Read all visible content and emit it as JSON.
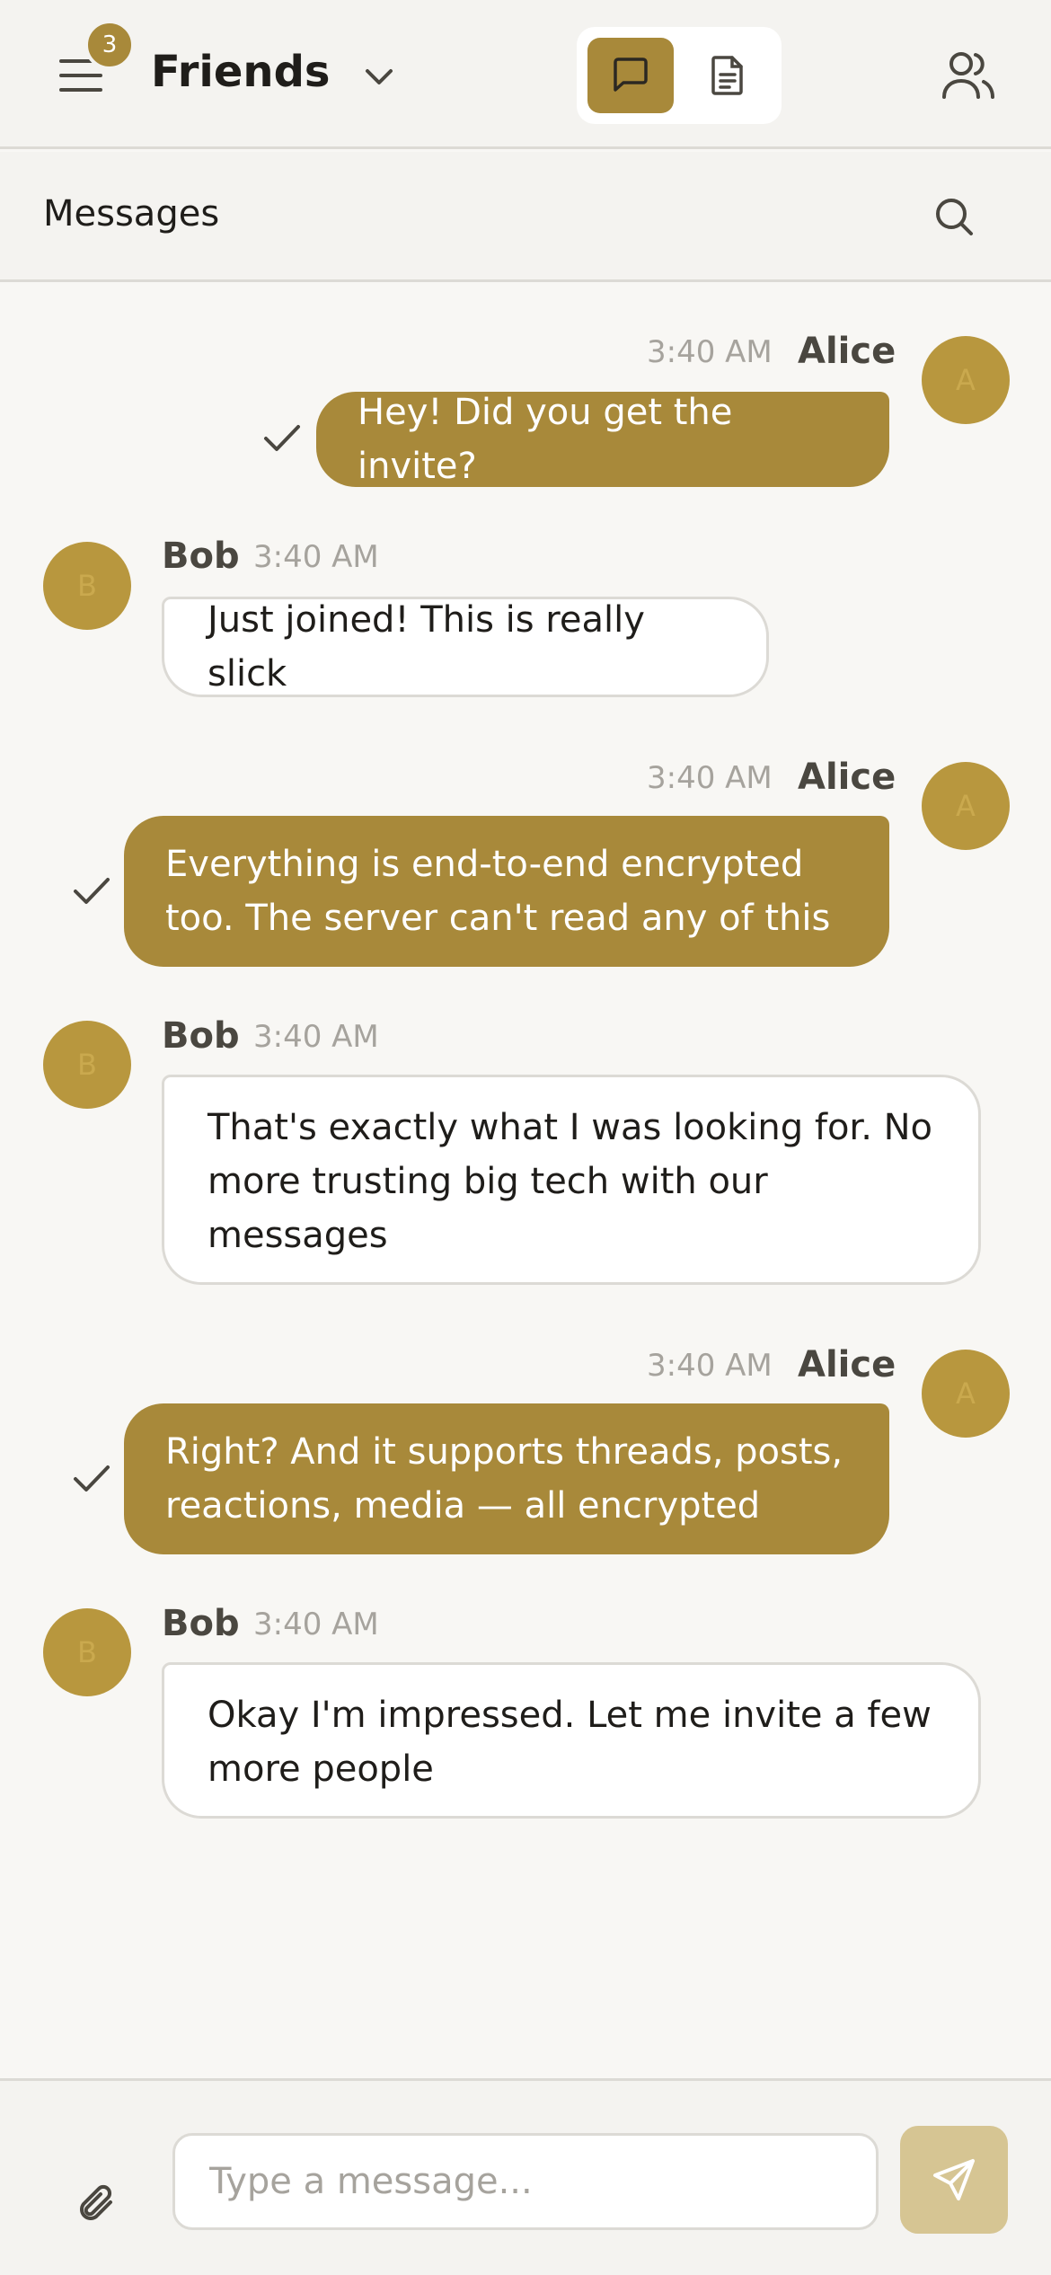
{
  "header": {
    "menu_badge_count": "3",
    "group_name": "Friends",
    "icons": {
      "menu": "menu-icon",
      "chevron": "chevron-down-icon",
      "chat_view": "chat-bubble-icon",
      "posts_view": "document-icon",
      "members": "users-icon"
    },
    "accent_color": "#a8893a"
  },
  "subheader": {
    "title": "Messages",
    "search_icon": "search-icon"
  },
  "messages": [
    {
      "author": "Alice",
      "avatar_letter": "A",
      "time": "3:40 AM",
      "direction": "outgoing",
      "text": "Hey! Did you get the invite?",
      "status": "check-icon"
    },
    {
      "author": "Bob",
      "avatar_letter": "B",
      "time": "3:40 AM",
      "direction": "incoming",
      "text": "Just joined! This is really slick"
    },
    {
      "author": "Alice",
      "avatar_letter": "A",
      "time": "3:40 AM",
      "direction": "outgoing",
      "lines": [
        "Everything is end-to-end encrypted",
        "too. The server can't read any of this"
      ],
      "status": "check-icon"
    },
    {
      "author": "Bob",
      "avatar_letter": "B",
      "time": "3:40 AM",
      "direction": "incoming",
      "lines": [
        "That's exactly what I was looking for. No",
        "more trusting big tech with our",
        "messages"
      ]
    },
    {
      "author": "Alice",
      "avatar_letter": "A",
      "time": "3:40 AM",
      "direction": "outgoing",
      "lines": [
        "Right? And it supports threads, posts,",
        "reactions, media — all encrypted"
      ],
      "status": "check-icon"
    },
    {
      "author": "Bob",
      "avatar_letter": "B",
      "time": "3:40 AM",
      "direction": "incoming",
      "lines": [
        "Okay I'm impressed. Let me invite a few",
        "more people"
      ]
    }
  ],
  "composer": {
    "placeholder": "Type a message...",
    "value": "",
    "attach_icon": "paperclip-icon",
    "send_icon": "send-icon"
  }
}
